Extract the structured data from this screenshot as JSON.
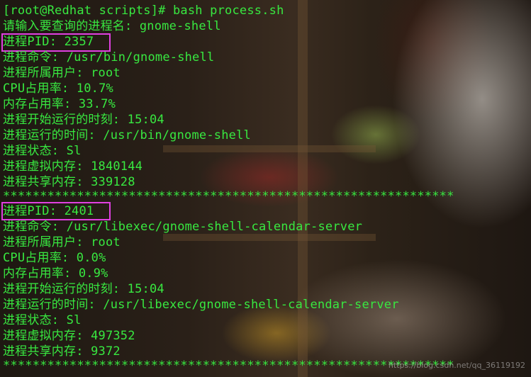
{
  "prompt": "[root@Redhat scripts]# bash process.sh",
  "input_line": "请输入要查询的进程名: gnome-shell",
  "process1": {
    "pid": "进程PID: 2357",
    "command": "进程命令: /usr/bin/gnome-shell",
    "user": "进程所属用户: root",
    "cpu": "CPU占用率: 10.7%",
    "mem": "内存占用率: 33.7%",
    "start": "进程开始运行的时刻: 15:04",
    "runtime": "进程运行的时间: /usr/bin/gnome-shell",
    "state": "进程状态: Sl",
    "vmem": "进程虚拟内存: 1840144",
    "shmem": "进程共享内存: 339128"
  },
  "separator": "*************************************************************",
  "process2": {
    "pid": "进程PID: 2401",
    "command": "进程命令: /usr/libexec/gnome-shell-calendar-server",
    "user": "进程所属用户: root",
    "cpu": "CPU占用率: 0.0%",
    "mem": "内存占用率: 0.9%",
    "start": "进程开始运行的时刻: 15:04",
    "runtime": "进程运行的时间: /usr/libexec/gnome-shell-calendar-server",
    "state": "进程状态: Sl",
    "vmem": "进程虚拟内存: 497352",
    "shmem": "进程共享内存: 9372"
  },
  "separator2": "*************************************************************",
  "watermark": "https://blog.csdn.net/qq_36119192",
  "colors": {
    "text": "#38e840",
    "highlight": "#e040e0"
  }
}
